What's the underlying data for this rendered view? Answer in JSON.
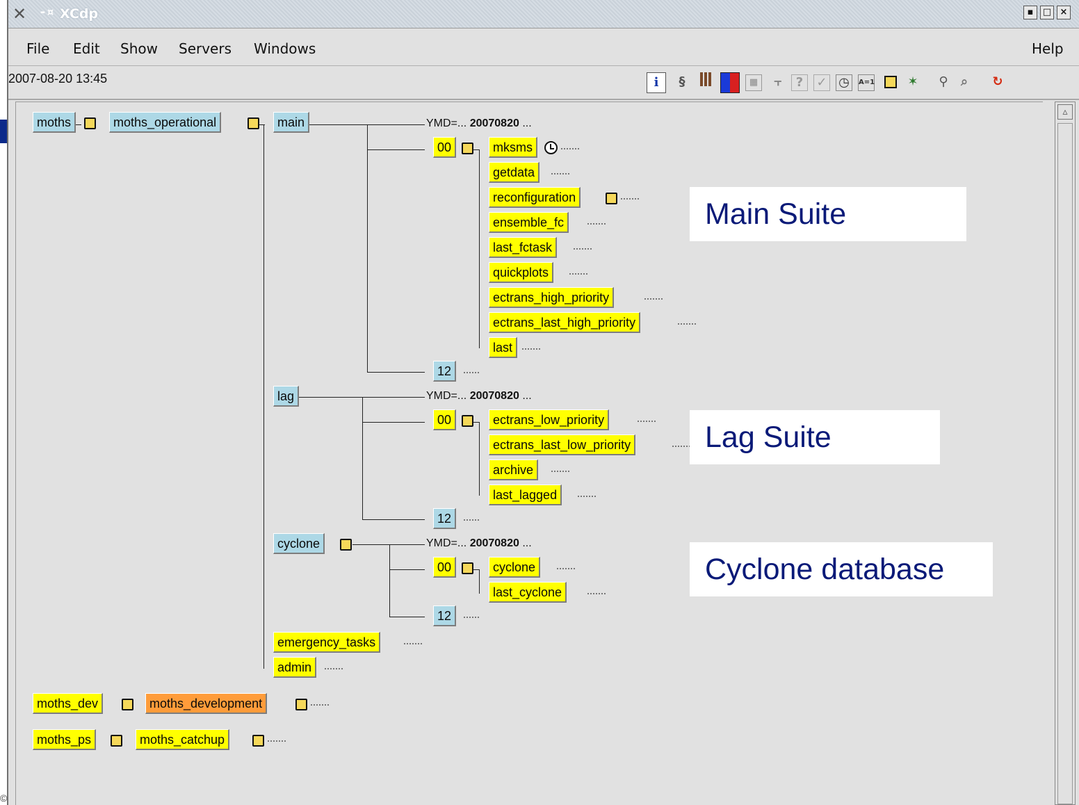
{
  "window": {
    "title": "XCdp",
    "pin_glyph": "-¤",
    "controls": {
      "minimize": "▪",
      "maximize": "□",
      "close": "×"
    }
  },
  "menu": [
    "File",
    "Edit",
    "Show",
    "Servers",
    "Windows"
  ],
  "menu_help": "Help",
  "datetime": "2007-08-20 13:45",
  "toolbar_icons": [
    "info-icon",
    "link-icon",
    "bars-icon",
    "color-grid-icon",
    "table-icon",
    "tree-icon",
    "question-icon",
    "check-icon",
    "clock-icon",
    "a1-icon",
    "note-icon",
    "satellite-icon",
    "wrench-icon",
    "search-icon",
    "refresh-icon"
  ],
  "tree": {
    "root": "moths",
    "root_suite": "moths_operational",
    "main": {
      "label": "main",
      "ymd_key": "YMD=...",
      "ymd_value": "20070820",
      "ymd_trail": "...",
      "family_00": "00",
      "tasks": [
        "mksms",
        "getdata",
        "reconfiguration",
        "ensemble_fc",
        "last_fctask",
        "quickplots",
        "ectrans_high_priority",
        "ectrans_last_high_priority",
        "last"
      ],
      "family_12": "12"
    },
    "lag": {
      "label": "lag",
      "ymd_key": "YMD=...",
      "ymd_value": "20070820",
      "ymd_trail": "...",
      "family_00": "00",
      "tasks": [
        "ectrans_low_priority",
        "ectrans_last_low_priority",
        "archive",
        "last_lagged"
      ],
      "family_12": "12"
    },
    "cyclone": {
      "label": "cyclone",
      "ymd_key": "YMD=...",
      "ymd_value": "20070820",
      "ymd_trail": "...",
      "family_00": "00",
      "tasks": [
        "cyclone",
        "last_cyclone"
      ],
      "family_12": "12"
    },
    "emergency": "emergency_tasks",
    "admin": "admin",
    "dev_server": "moths_dev",
    "dev_suite": "moths_development",
    "ps_server": "moths_ps",
    "ps_suite": "moths_catchup",
    "dots": "----"
  },
  "annotations": {
    "main": "Main Suite",
    "lag": "Lag Suite",
    "cyclone": "Cyclone database"
  },
  "footer_mark": "©",
  "colors": {
    "server_blue": "#add8e6",
    "queued_yellow": "#ffff00",
    "suspended_orange": "#ff9c3a",
    "background": "#e1e1e1",
    "annotation_text": "#0a1a78"
  }
}
